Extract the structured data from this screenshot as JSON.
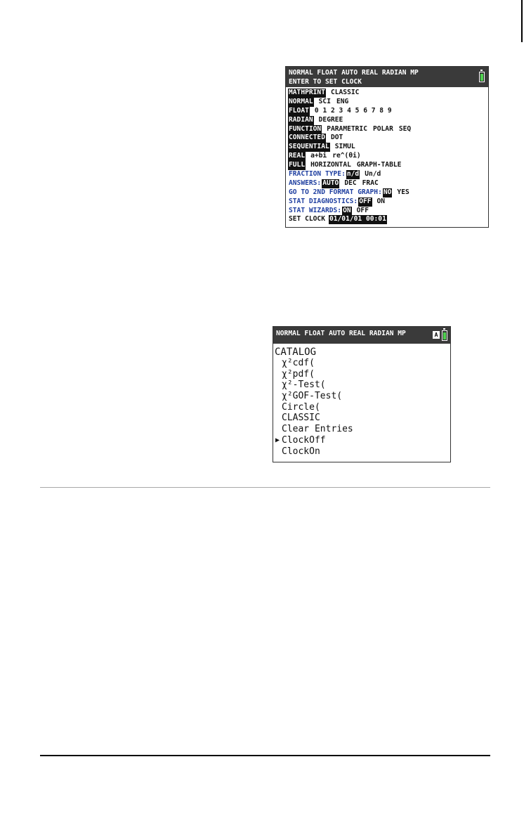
{
  "mode_screen": {
    "status_line_1": "NORMAL FLOAT AUTO REAL RADIAN MP",
    "status_line_2": "ENTER TO SET CLOCK",
    "rows": [
      {
        "label": "MATHPRINT",
        "options": [
          "CLASSIC"
        ]
      },
      {
        "label": "NORMAL",
        "options": [
          "SCI",
          "ENG"
        ]
      },
      {
        "label": "FLOAT",
        "options": [
          "0 1 2 3 4 5 6 7 8 9"
        ]
      },
      {
        "label": "RADIAN",
        "options": [
          "DEGREE"
        ]
      },
      {
        "label": "FUNCTION",
        "options": [
          "PARAMETRIC",
          "POLAR",
          "SEQ"
        ]
      },
      {
        "label": "CONNECTED",
        "options": [
          "DOT"
        ]
      },
      {
        "label": "SEQUENTIAL",
        "options": [
          "SIMUL"
        ]
      },
      {
        "label": "REAL",
        "options": [
          "a+bi",
          "re^(θi)"
        ]
      },
      {
        "label": "FULL",
        "options": [
          "HORIZONTAL",
          "GRAPH-TABLE"
        ]
      },
      {
        "label": "FRACTION TYPE:",
        "selected": "n/d",
        "options": [
          "Un/d"
        ]
      },
      {
        "label": "ANSWERS:",
        "selected": "AUTO",
        "options": [
          "DEC",
          "FRAC"
        ]
      },
      {
        "label": "GO TO 2ND FORMAT GRAPH:",
        "selected": "NO",
        "options": [
          "YES"
        ]
      },
      {
        "label": "STAT DIAGNOSTICS:",
        "selected": "OFF",
        "options": [
          "ON"
        ]
      },
      {
        "label": "STAT WIZARDS:",
        "selected": "ON",
        "options": [
          "OFF"
        ]
      },
      {
        "label": "SET CLOCK",
        "selected": "01/01/01 00:01"
      }
    ]
  },
  "catalog_screen": {
    "status_line": "NORMAL FLOAT AUTO REAL RADIAN MP",
    "alpha_indicator": "A",
    "title": "CATALOG",
    "items": [
      "χ²cdf(",
      "χ²pdf(",
      "χ²-Test(",
      "χ²GOF-Test(",
      "Circle(",
      "CLASSIC",
      "Clear Entries",
      "ClockOff",
      "ClockOn"
    ],
    "cursor_glyph": "▶"
  },
  "colors": {
    "status_bar": "#3a3a3a",
    "blue_label": "#1f3fa0",
    "battery": "#4fd04f"
  }
}
